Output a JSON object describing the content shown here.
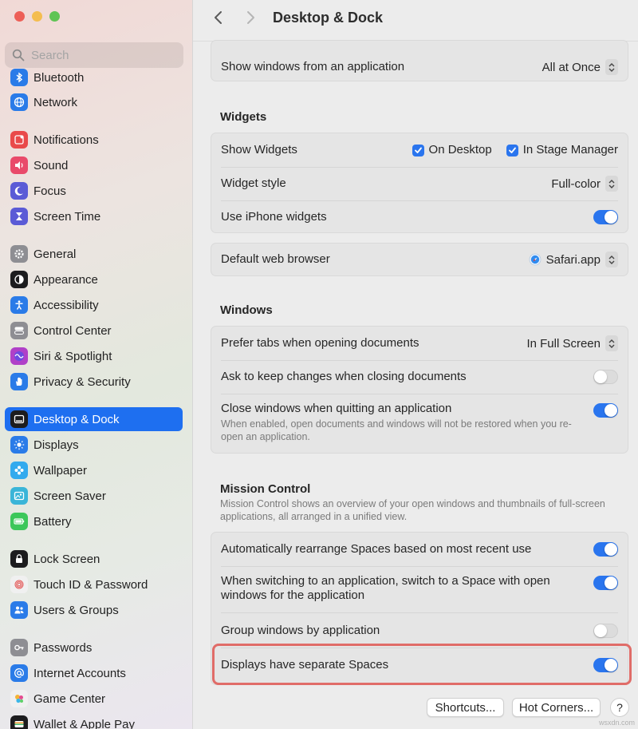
{
  "window": {
    "title": "Desktop & Dock"
  },
  "search": {
    "placeholder": "Search"
  },
  "sidebar": {
    "items": [
      {
        "label": "Bluetooth",
        "icon": "bluetooth-icon",
        "color": "#2a7be8"
      },
      {
        "label": "Network",
        "icon": "globe-icon",
        "color": "#2a7be8"
      },
      {
        "label": "Notifications",
        "icon": "bell-icon",
        "color": "#e94a4a"
      },
      {
        "label": "Sound",
        "icon": "speaker-icon",
        "color": "#e94a6a"
      },
      {
        "label": "Focus",
        "icon": "moon-icon",
        "color": "#5b5bd6"
      },
      {
        "label": "Screen Time",
        "icon": "hourglass-icon",
        "color": "#5b5bd6"
      },
      {
        "label": "General",
        "icon": "gear-icon",
        "color": "#8e8e93"
      },
      {
        "label": "Appearance",
        "icon": "appearance-icon",
        "color": "#1c1c1e"
      },
      {
        "label": "Accessibility",
        "icon": "accessibility-icon",
        "color": "#2a7be8"
      },
      {
        "label": "Control Center",
        "icon": "toggles-icon",
        "color": "#8e8e93"
      },
      {
        "label": "Siri & Spotlight",
        "icon": "siri-icon",
        "color": "#b040c8"
      },
      {
        "label": "Privacy & Security",
        "icon": "hand-icon",
        "color": "#2a7be8"
      },
      {
        "label": "Desktop & Dock",
        "icon": "dock-icon",
        "color": "#1c1c1e"
      },
      {
        "label": "Displays",
        "icon": "sun-icon",
        "color": "#2a7be8"
      },
      {
        "label": "Wallpaper",
        "icon": "flower-icon",
        "color": "#33aaee"
      },
      {
        "label": "Screen Saver",
        "icon": "screensaver-icon",
        "color": "#3ab5d8"
      },
      {
        "label": "Battery",
        "icon": "battery-icon",
        "color": "#3cc75a"
      },
      {
        "label": "Lock Screen",
        "icon": "lock-icon",
        "color": "#1c1c1e"
      },
      {
        "label": "Touch ID & Password",
        "icon": "fingerprint-icon",
        "color": "#f0f0f0"
      },
      {
        "label": "Users & Groups",
        "icon": "users-icon",
        "color": "#2a7be8"
      },
      {
        "label": "Passwords",
        "icon": "key-icon",
        "color": "#8e8e93"
      },
      {
        "label": "Internet Accounts",
        "icon": "at-icon",
        "color": "#2a7be8"
      },
      {
        "label": "Game Center",
        "icon": "game-center-icon",
        "color": "#f0f0f0"
      },
      {
        "label": "Wallet & Apple Pay",
        "icon": "wallet-icon",
        "color": "#1c1c1e"
      }
    ]
  },
  "rows": {
    "show_windows": {
      "label": "Show windows from an application",
      "value": "All at Once"
    },
    "widgets_title": "Widgets",
    "show_widgets": {
      "label": "Show Widgets",
      "opt1": "On Desktop",
      "opt2": "In Stage Manager"
    },
    "widget_style": {
      "label": "Widget style",
      "value": "Full-color"
    },
    "iphone_widgets": {
      "label": "Use iPhone widgets"
    },
    "browser": {
      "label": "Default web browser",
      "value": "Safari.app"
    },
    "windows_title": "Windows",
    "prefer_tabs": {
      "label": "Prefer tabs when opening documents",
      "value": "In Full Screen"
    },
    "ask_keep": {
      "label": "Ask to keep changes when closing documents"
    },
    "close_windows": {
      "label": "Close windows when quitting an application",
      "sub": "When enabled, open documents and windows will not be restored when you re-open an application."
    },
    "mission_title": "Mission Control",
    "mission_desc": "Mission Control shows an overview of your open windows and thumbnails of full-screen applications, all arranged in a unified view.",
    "auto_rearrange": {
      "label": "Automatically rearrange Spaces based on most recent use"
    },
    "switch_space": {
      "label": "When switching to an application, switch to a Space with open windows for the application"
    },
    "group_windows": {
      "label": "Group windows by application"
    },
    "separate_spaces": {
      "label": "Displays have separate Spaces"
    }
  },
  "buttons": {
    "shortcuts": "Shortcuts...",
    "hot_corners": "Hot Corners...",
    "help": "?"
  },
  "watermark": "wsxdn.com",
  "colors": {
    "accent": "#2a75ee",
    "highlight": "#e06c68"
  }
}
